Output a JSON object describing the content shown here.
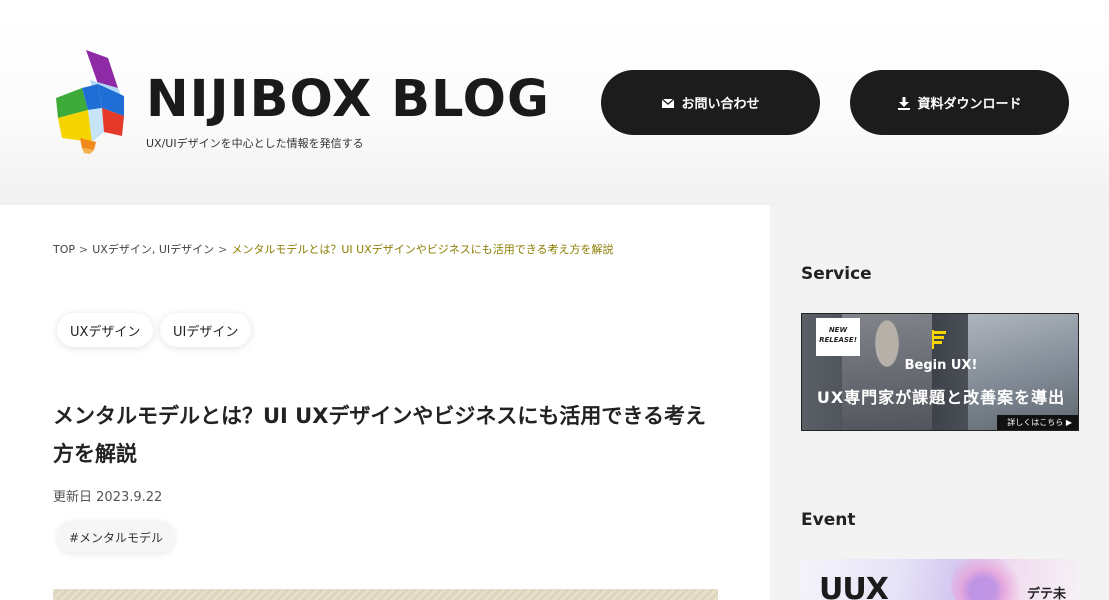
{
  "header": {
    "logo_text": "NIJIBOX BLOG",
    "tagline": "UX/UIデザインを中心とした情報を発信する",
    "contact_label": "お問い合わせ",
    "download_label": "資料ダウンロード"
  },
  "breadcrumb": {
    "top": "TOP",
    "sep": ">",
    "cat1": "UXデザイン",
    "comma": ",",
    "cat2": "UIデザイン",
    "current": "メンタルモデルとは？UI UXデザインやビジネスにも活用できる考え方を解説"
  },
  "article": {
    "categories": [
      "UXデザイン",
      "UIデザイン"
    ],
    "title": "メンタルモデルとは？UI UXデザインやビジネスにも活用できる考え方を解説",
    "date_label": "更新日",
    "date": "2023.9.22",
    "hashtag": "#メンタルモデル"
  },
  "sidebar": {
    "service_heading": "Service",
    "event_heading": "Event",
    "service_banner": {
      "badge": "NEW RELEASE!",
      "begin": "Begin UX!",
      "headline": "UX専門家が課題と改善案を導出",
      "more": "詳しくはこちら ▶"
    },
    "event_banner": {
      "logo": "UUX",
      "text": "デテ未"
    }
  },
  "colors": {
    "button_bg": "#1c1c1c",
    "breadcrumb_current": "#8a7d00",
    "logo_purple": "#8e2aa6",
    "logo_blue": "#1e6ed6",
    "logo_yellow": "#f5d400",
    "logo_red": "#e53a2a",
    "logo_green": "#3dab3a"
  },
  "icons": {
    "contact": "mail-icon",
    "download": "download-icon"
  }
}
